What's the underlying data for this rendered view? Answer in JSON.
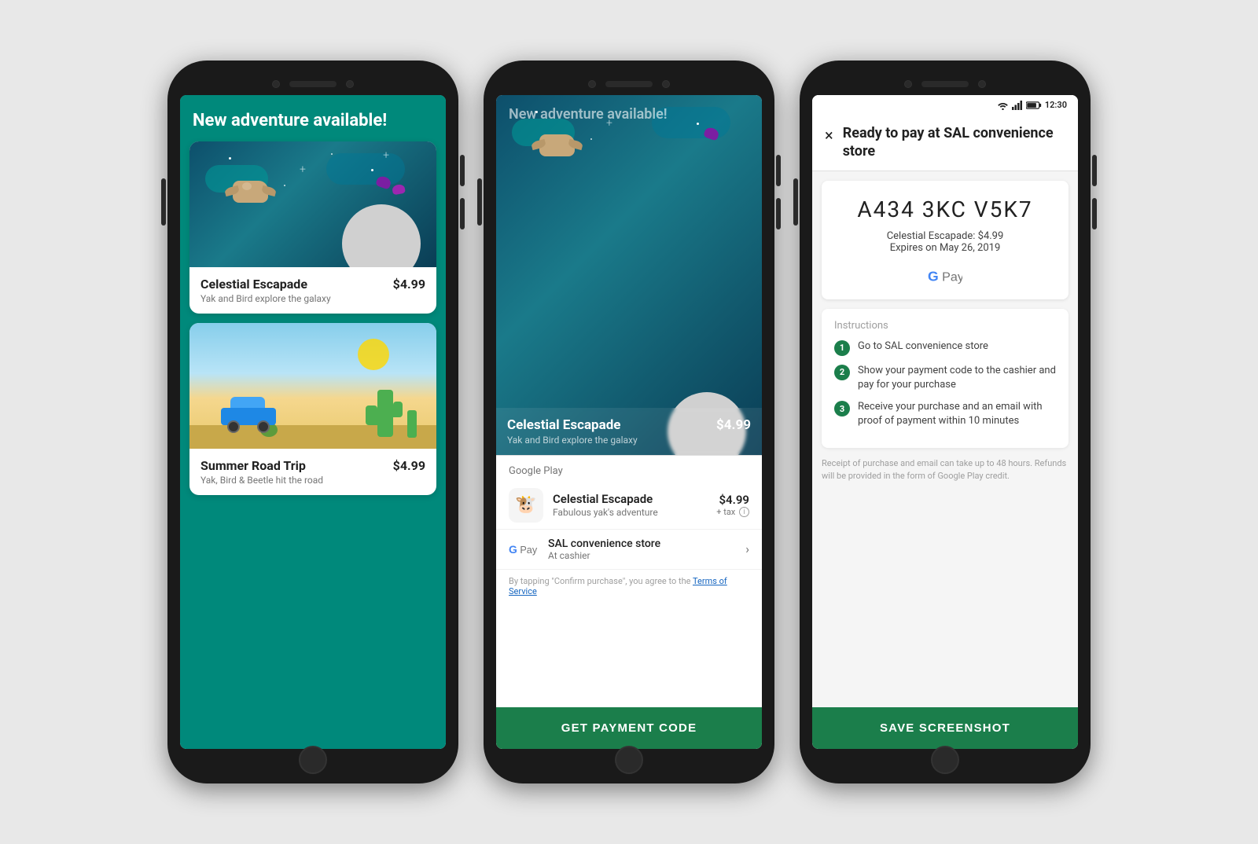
{
  "phones": {
    "phone1": {
      "screen_type": "store",
      "header": "New adventure available!",
      "cards": [
        {
          "id": "celestial",
          "type": "space",
          "title": "Celestial Escapade",
          "subtitle": "Yak and Bird explore the galaxy",
          "price": "$4.99"
        },
        {
          "id": "summer",
          "type": "desert",
          "title": "Summer Road Trip",
          "subtitle": "Yak, Bird & Beetle hit the road",
          "price": "$4.99"
        }
      ]
    },
    "phone2": {
      "screen_type": "purchase",
      "header_overlay": "New adventure available!",
      "game_title": "Celestial Escapade",
      "game_subtitle": "Yak and Bird explore the galaxy",
      "game_price": "$4.99",
      "sheet_header": "Google Play",
      "item_name": "Celestial Escapade",
      "item_sub": "Fabulous yak's adventure",
      "item_price": "$4.99",
      "item_tax": "+ tax",
      "payment_provider": "SAL convenience store",
      "payment_sub": "At cashier",
      "terms": "By tapping \"Confirm purchase\", you agree to the",
      "terms_link": "Terms of Service",
      "btn_label": "GET  PAYMENT CODE"
    },
    "phone3": {
      "screen_type": "payment_code",
      "status_time": "12:30",
      "close_icon": "×",
      "title": "Ready to pay at SAL convenience store",
      "code": "A434 3KC V5K7",
      "code_item": "Celestial Escapade: $4.99",
      "code_expires": "Expires on May 26, 2019",
      "gpay_label": "Pay",
      "instructions_label": "Instructions",
      "instructions": [
        "Go to SAL convenience store",
        "Show your payment code to the cashier and pay for your purchase",
        "Receive your purchase and an email with proof of payment within 10 minutes"
      ],
      "disclaimer": "Receipt of purchase and email can take up to 48 hours. Refunds will be provided in the form of Google Play credit.",
      "save_btn": "SAVE SCREENSHOT"
    }
  }
}
